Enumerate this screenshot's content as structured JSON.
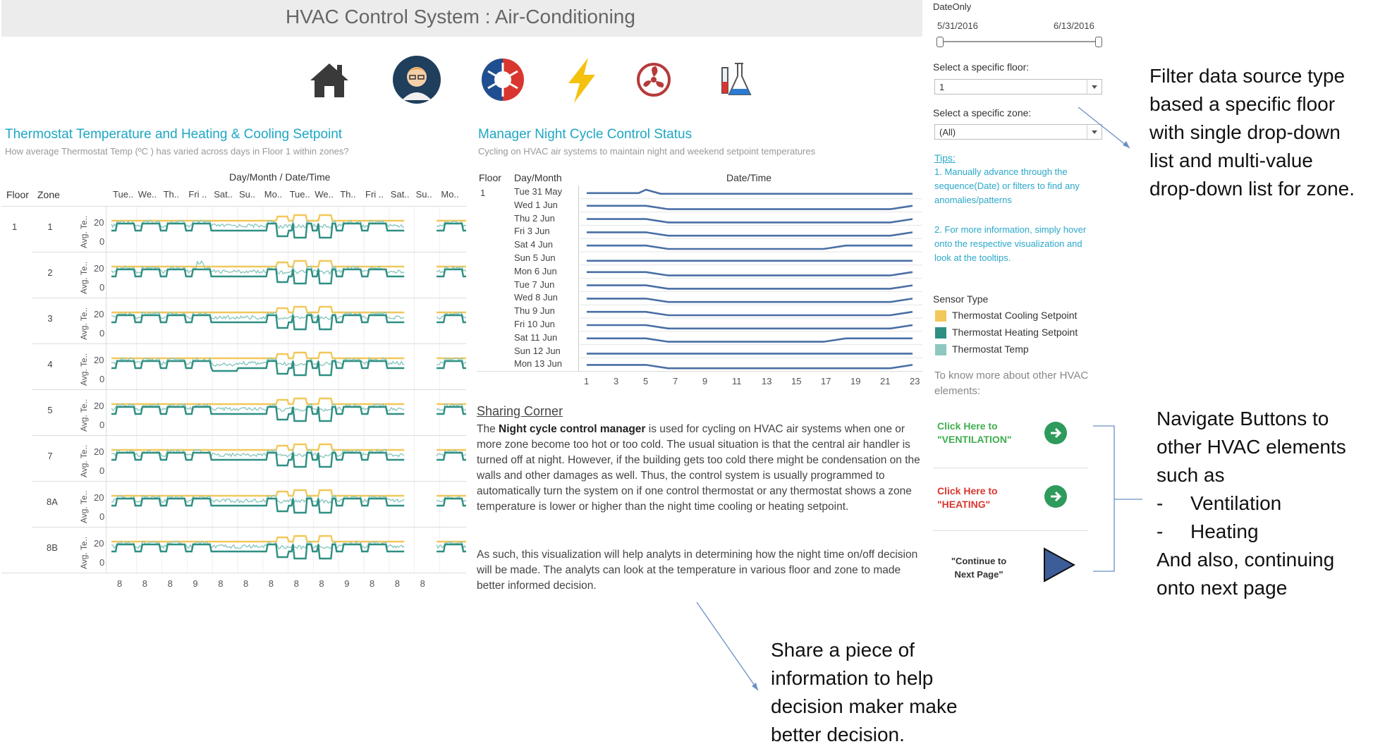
{
  "header": {
    "title": "HVAC Control System : Air-Conditioning"
  },
  "nav_icons": [
    {
      "name": "home-icon",
      "color": "#3a3a3a"
    },
    {
      "name": "manager-avatar-icon",
      "color": "#1f3f5c"
    },
    {
      "name": "heating-cooling-icon",
      "color": "#d9362f"
    },
    {
      "name": "lightning-icon",
      "color": "#f4c10f"
    },
    {
      "name": "fan-icon",
      "color": "#b63a3a"
    },
    {
      "name": "lab-flask-icon",
      "color": "#2b7bd1"
    }
  ],
  "thermostat": {
    "title": "Thermostat Temperature and Heating & Cooling Setpoint",
    "subtitle": "How average Thermostat Temp (ºC ) has varied across days in Floor 1 within zones?",
    "col_header": "Day/Month  /  Date/Time",
    "floor_label": "Floor",
    "zone_label": "Zone",
    "axis_label": "Avg. Te..",
    "days": [
      "Tue..",
      "We..",
      "Th..",
      "Fri ..",
      "Sat..",
      "Su..",
      "Mo..",
      "Tue..",
      "We..",
      "Th..",
      "Fri ..",
      "Sat..",
      "Su..",
      "Mo.."
    ],
    "floor": "1",
    "zones": [
      "1",
      "2",
      "3",
      "4",
      "5",
      "7",
      "8A",
      "8B"
    ],
    "y_ticks": [
      "20",
      "0"
    ],
    "x_ticks": [
      "8",
      "8",
      "8",
      "9",
      "8",
      "8",
      "8",
      "8",
      "8",
      "9",
      "8",
      "8",
      "8"
    ]
  },
  "night_cycle": {
    "title": "Manager Night Cycle Control Status",
    "subtitle": "Cycling on HVAC air systems to maintain night and weekend setpoint temperatures",
    "floor_label": "Floor",
    "daymonth_label": "Day/Month",
    "datetime_label": "Date/Time",
    "floor": "1",
    "days": [
      "Tue 31 May",
      "Wed 1 Jun",
      "Thu 2 Jun",
      "Fri 3 Jun",
      "Sat 4 Jun",
      "Sun 5 Jun",
      "Mon 6 Jun",
      "Tue 7 Jun",
      "Wed 8 Jun",
      "Thu 9 Jun",
      "Fri 10 Jun",
      "Sat 11 Jun",
      "Sun 12 Jun",
      "Mon 13 Jun"
    ],
    "x_ticks": [
      "1",
      "3",
      "5",
      "7",
      "9",
      "11",
      "13",
      "15",
      "17",
      "19",
      "21",
      "23"
    ],
    "line_color": "#4a6fa5"
  },
  "sharing": {
    "heading": "Sharing Corner",
    "para1_prefix": "The ",
    "para1_bold": "Night cycle control manager",
    "para1_rest": " is used for cycling on HVAC air systems when one or more zone become too hot or too cold. The usual situation is that the central air handler is turned off at night. However, if the building gets too cold there might be condensation on the walls and other damages as well. Thus, the control system is usually programmed to automatically turn the system on if one control thermostat or any thermostat shows a zone temperature is lower or higher than the night time cooling or heating setpoint.",
    "para2": "As such, this visualization will help analyts in determining how the night time on/off decision will be made. The analyts can look at the temperature in various floor and zone to made better informed decision."
  },
  "filters": {
    "date_label": "DateOnly",
    "date_start": "5/31/2016",
    "date_end": "6/13/2016",
    "floor_label": "Select a specific floor:",
    "floor_value": "1",
    "zone_label": "Select a specific zone:",
    "zone_value": "(All)"
  },
  "tips": {
    "heading": "Tips:",
    "tip1": "1. Manually advance through the sequence(Date) or filters to find any anomalies/patterns",
    "tip2": "2. For more information, simply hover onto the respective visualization and look at the tooltips."
  },
  "legend": {
    "title": "Sensor Type",
    "items": [
      {
        "label": "Thermostat Cooling Setpoint",
        "color": "#f2c85b"
      },
      {
        "label": "Thermostat Heating Setpoint",
        "color": "#2f8f83"
      },
      {
        "label": "Thermostat Temp",
        "color": "#8cc8bf"
      }
    ]
  },
  "more_info": "To know more about other HVAC elements:",
  "nav_buttons": {
    "ventilation_line1": "Click Here to",
    "ventilation_line2": "\"VENTILATION\"",
    "ventilation_color": "#3fae4d",
    "heating_line1": "Click Here to",
    "heating_line2": "\"HEATING\"",
    "heating_color": "#d9362f",
    "continue_line1": "\"Continue to",
    "continue_line2": "Next Page\""
  },
  "annotations": {
    "filter_lines": [
      "Filter data source type",
      "based a specific floor",
      "with single drop-down",
      "list and multi-value",
      "drop-down list for zone."
    ],
    "navigate_lines": [
      "Navigate Buttons to",
      "other HVAC elements",
      "such as"
    ],
    "navigate_items": [
      "Ventilation",
      "Heating"
    ],
    "navigate_tail": [
      "And also, continuing",
      "onto next page"
    ],
    "share_lines": [
      "Share a piece of",
      "information to help",
      "decision maker make",
      "better decision."
    ]
  }
}
